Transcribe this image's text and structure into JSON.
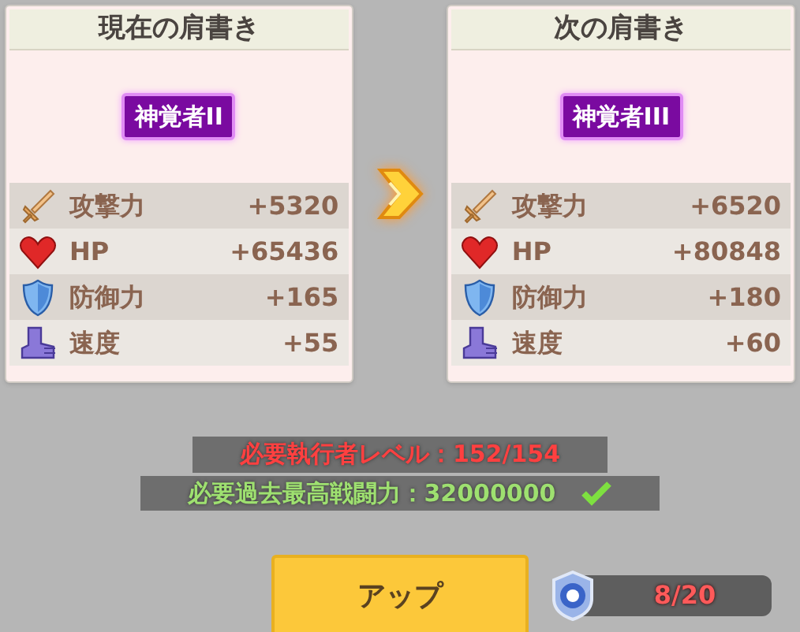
{
  "cards": [
    {
      "title": "現在の肩書き",
      "badge": "神覚者II",
      "stats": [
        {
          "kind": "attack",
          "label": "攻撃力",
          "value": "+5320"
        },
        {
          "kind": "hp",
          "label": "HP",
          "value": "+65436"
        },
        {
          "kind": "defense",
          "label": "防御力",
          "value": "+165"
        },
        {
          "kind": "speed",
          "label": "速度",
          "value": "+55"
        }
      ]
    },
    {
      "title": "次の肩書き",
      "badge": "神覚者III",
      "stats": [
        {
          "kind": "attack",
          "label": "攻撃力",
          "value": "+6520"
        },
        {
          "kind": "hp",
          "label": "HP",
          "value": "+80848"
        },
        {
          "kind": "defense",
          "label": "防御力",
          "value": "+180"
        },
        {
          "kind": "speed",
          "label": "速度",
          "value": "+60"
        }
      ]
    }
  ],
  "requirements": [
    {
      "text": "必要執行者レベル：152/154",
      "met": false
    },
    {
      "text": "必要過去最高戦闘力：32000000",
      "met": true
    }
  ],
  "up_button": {
    "label": "アップ"
  },
  "counter": {
    "text": "8/20"
  }
}
